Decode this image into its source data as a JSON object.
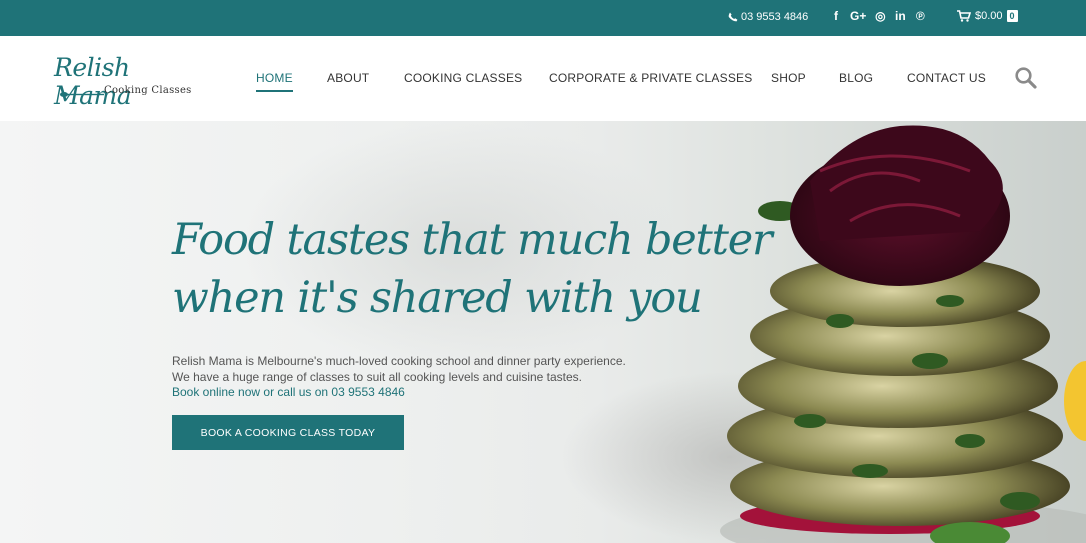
{
  "topbar": {
    "phone": "03 9553 4846",
    "social_icons": [
      "facebook-icon",
      "google-plus-icon",
      "instagram-icon",
      "linkedin-icon",
      "pinterest-icon"
    ],
    "social_glyphs": {
      "facebook": "f",
      "google_plus": "G+",
      "instagram": "◎",
      "linkedin": "in",
      "pinterest": "℗"
    },
    "cart_total": "$0.00",
    "cart_count": "0"
  },
  "header": {
    "logo_script": "Relish Mama",
    "logo_sub": "Cooking Classes",
    "nav": [
      {
        "label": "HOME",
        "active": true
      },
      {
        "label": "ABOUT"
      },
      {
        "label": "COOKING CLASSES"
      },
      {
        "label": "CORPORATE & PRIVATE CLASSES"
      },
      {
        "label": "SHOP"
      },
      {
        "label": "BLOG"
      },
      {
        "label": "CONTACT US"
      }
    ]
  },
  "hero": {
    "headline_line1": "Food tastes that much better",
    "headline_line2": "when it's shared with you",
    "intro_line1": "Relish Mama is Melbourne's much-loved cooking school and dinner party experience.",
    "intro_line2": "We have a huge range of classes to suit all cooking levels and cuisine tastes.",
    "intro_link": "Book online now or call us on 03 9553 4846",
    "cta": "BOOK A COOKING CLASS TODAY"
  },
  "colors": {
    "brand": "#1f7378",
    "topbar_text": "#ffffff",
    "nav_text": "#333333"
  }
}
